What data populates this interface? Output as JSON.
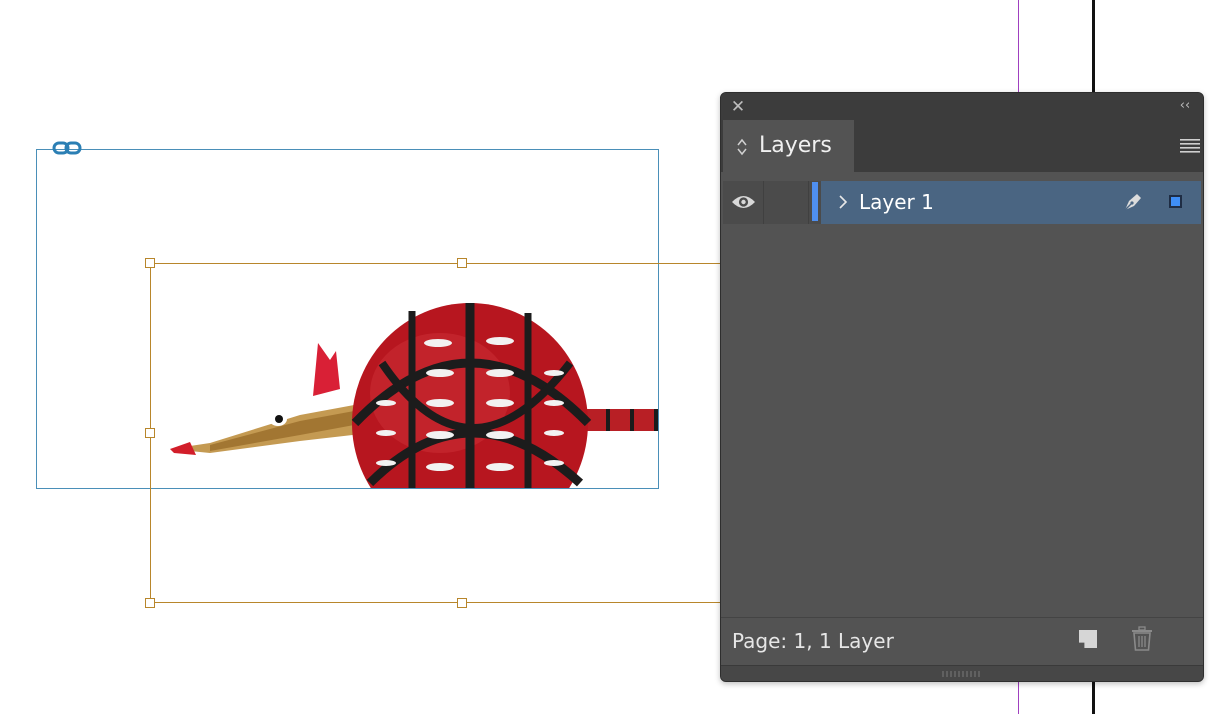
{
  "panel": {
    "close_glyph": "✕",
    "collapse_glyph": "‹‹",
    "tab_label": "Layers",
    "layers": [
      {
        "name": "Layer 1",
        "visible": true,
        "color": "#4f8ff0",
        "selected": true
      }
    ],
    "status_text": "Page: 1, 1 Layer"
  },
  "icons": {
    "close": "close-icon",
    "collapse": "double-chevron-left-icon",
    "tab_arrows": "up-down-arrows-icon",
    "menu": "hamburger-menu-icon",
    "visibility": "eye-icon",
    "disclosure": "chevron-right-icon",
    "pen": "pen-icon",
    "target": "selection-square-icon",
    "new_layer": "new-layer-icon",
    "delete": "trash-icon",
    "link": "link-icon"
  },
  "colors": {
    "link_frame": "#4a8fb8",
    "content_frame": "#b8862b",
    "panel_bg": "#535353",
    "selection_bg": "#4a6582",
    "layer_color": "#4f8ff0"
  }
}
